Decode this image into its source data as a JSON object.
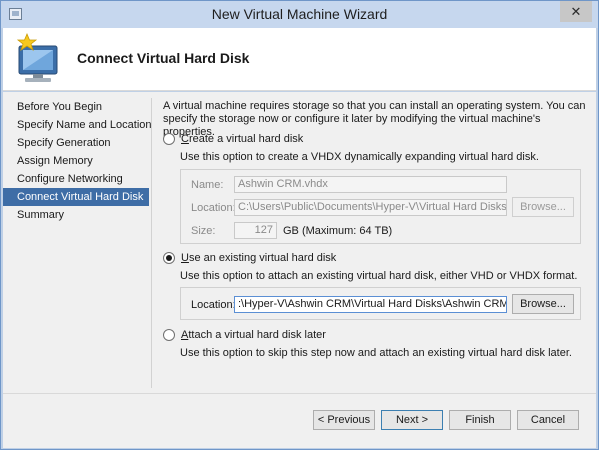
{
  "window": {
    "title": "New Virtual Machine Wizard",
    "close_glyph": "✕"
  },
  "header": {
    "title": "Connect Virtual Hard Disk",
    "icon": "vm-monitor-star-icon"
  },
  "nav": {
    "items": [
      {
        "label": "Before You Begin"
      },
      {
        "label": "Specify Name and Location"
      },
      {
        "label": "Specify Generation"
      },
      {
        "label": "Assign Memory"
      },
      {
        "label": "Configure Networking"
      },
      {
        "label": "Connect Virtual Hard Disk"
      },
      {
        "label": "Summary"
      }
    ],
    "active_index": 5
  },
  "main": {
    "intro": "A virtual machine requires storage so that you can install an operating system. You can specify the storage now or configure it later by modifying the virtual machine's properties.",
    "create": {
      "label_access": "C",
      "label_rest": "reate a virtual hard disk",
      "desc": "Use this option to create a VHDX dynamically expanding virtual hard disk.",
      "name_label": "Name:",
      "name_value": "Ashwin CRM.vhdx",
      "location_label": "Location:",
      "location_value": "C:\\Users\\Public\\Documents\\Hyper-V\\Virtual Hard Disks\\",
      "browse_label": "Browse...",
      "size_label": "Size:",
      "size_value": "127",
      "size_unit": "GB (Maximum: 64 TB)"
    },
    "existing": {
      "label_access": "U",
      "label_rest": "se an existing virtual hard disk",
      "desc": "Use this option to attach an existing virtual hard disk, either VHD or VHDX format.",
      "location_label": "Location:",
      "location_value": ":\\Hyper-V\\Ashwin CRM\\Virtual Hard Disks\\Ashwin CRM.vhd",
      "browse_label": "Browse..."
    },
    "later": {
      "label_access": "A",
      "label_rest": "ttach a virtual hard disk later",
      "desc": "Use this option to skip this step now and attach an existing virtual hard disk later."
    },
    "selected_option": "existing"
  },
  "footer": {
    "previous": "< Previous",
    "next": "Next >",
    "finish": "Finish",
    "cancel": "Cancel"
  }
}
